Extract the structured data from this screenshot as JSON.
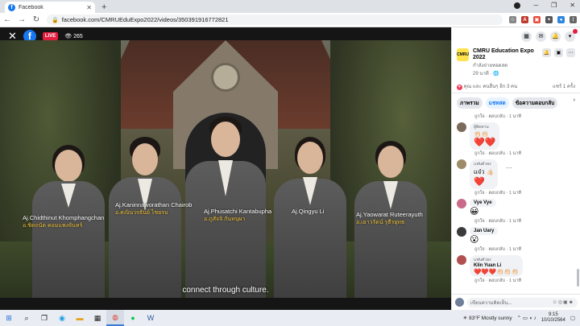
{
  "browser": {
    "tab_title": "Facebook",
    "url": "facebook.com/CMRUEduExpo2022/videos/350391916772821"
  },
  "video": {
    "live_label": "แชร์",
    "viewers": "265",
    "subtitle": "connect through culture.",
    "people": [
      {
        "name_en": "Aj.Chidthinut Khomphangchan",
        "name_th": "อ.ชิดถนัด คอมแพงจันทร์"
      },
      {
        "name_en": "Aj.Kaninnaworathan Chairob",
        "name_th": "อ.คณินวรธันย์ ไชยรบ"
      },
      {
        "name_en": "Aj.Phusatchi Kantabupha",
        "name_th": "อ.ภูสัจจิ กันทบุผา"
      },
      {
        "name_en": "Aj.Qingyu Li",
        "name_th": ""
      },
      {
        "name_en": "Aj.Yaowarat Ruteerayuth",
        "name_th": "อ.เยาวรัตน์ รุธีรยุทธ"
      }
    ]
  },
  "panel": {
    "page_name": "CMRU Education Expo 2022",
    "page_status": "กำลังถ่ายทอดสด",
    "page_time": "29 นาที · 🌐",
    "reactions_text": "คุณ และ คนอื่นๆ อีก 3 คน",
    "shares": "แชร์ 1 ครั้ง",
    "tabs": [
      "ภาพรวม",
      "แชทสด",
      "ข้อความตอบกลับ"
    ],
    "comments": [
      {
        "role": "ผู้ติดตาม",
        "author": "",
        "text": "👏🏻👏🏻",
        "big": "❤️❤️",
        "meta": "ถูกใจ · ตอบกลับ · 1 นาที"
      },
      {
        "role": "แฟนตัวยง",
        "author": "",
        "text": "แจ๋ว 👍🏻",
        "big": "❤️",
        "meta": "ถูกใจ · ตอบกลับ · 1 นาที"
      },
      {
        "role": "",
        "author": "Vye Vye",
        "text": "",
        "big": "😀",
        "meta": "ถูกใจ · ตอบกลับ · 1 นาที"
      },
      {
        "role": "",
        "author": "Jan Uary",
        "text": "",
        "big": "😮",
        "meta": "ถูกใจ · ตอบกลับ · 1 นาที"
      },
      {
        "role": "แฟนตัวยง",
        "author": "Klin Yuan Li",
        "text": "❤️❤️❤️👏🏻👏🏻👏🏻",
        "big": "",
        "meta": "ถูกใจ · ตอบกลับ · 1 นาที"
      }
    ],
    "top_meta": "ถูกใจ · ตอบกลับ · 1 นาที",
    "comment_placeholder": "เขียนความคิดเห็น..."
  },
  "taskbar": {
    "weather": "83°F  Mostly sunny",
    "time": "9:15",
    "date": "10/10/2564"
  }
}
